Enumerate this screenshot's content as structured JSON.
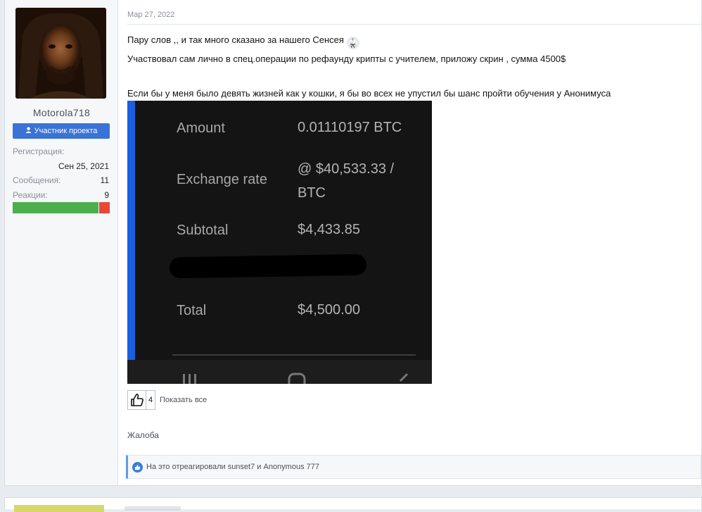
{
  "user": {
    "name": "Motorola718",
    "role": "Участник проекта",
    "stats": [
      {
        "label": "Регистрация:",
        "value": "Сен 25, 2021"
      },
      {
        "label": "Сообщения:",
        "value": "11"
      },
      {
        "label": "Реакции:",
        "value": "9"
      }
    ],
    "reaction_ratio_positive": 0.89
  },
  "post": {
    "date": "Мар 27, 2022",
    "line1": "Пару слов ,, и так много сказано за нашего Сенсея",
    "line2": "Участвовал сам лично в спец.операции по рефаунду крипты с учителем, приложу скрин , сумма 4500$",
    "line3": "Если бы у меня было девять жизней как у кошки, я бы во всех не упустил бы шанс пройти обучения у Анонимуса",
    "emoji_icon": "martial-arts-uniform-icon",
    "screenshot": {
      "rows": [
        {
          "label": "Amount",
          "value": "0.01110197 BTC"
        },
        {
          "label": "Exchange rate",
          "value": "@ $40,533.33 / BTC"
        },
        {
          "label": "Subtotal",
          "value": "$4,433.85"
        },
        {
          "label": "Total",
          "value": "$4,500.00"
        }
      ],
      "accent_color": "#1a5fe0"
    },
    "like_count": "4",
    "show_all": "Показать все",
    "report": "Жалоба",
    "reactions_text": "На это отреагировали sunset7 и Anonymous 777"
  },
  "colors": {
    "role_badge": "#3a73d6",
    "positive": "#4cae4c",
    "negative": "#e8473b"
  }
}
